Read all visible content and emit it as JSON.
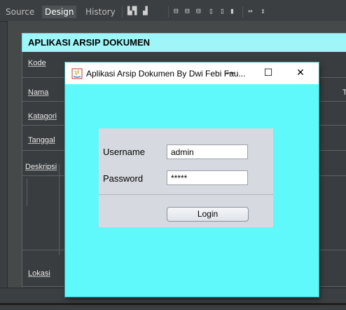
{
  "ide": {
    "tabs": [
      {
        "label": "Source"
      },
      {
        "label": "Design"
      },
      {
        "label": "History"
      }
    ]
  },
  "form": {
    "header_title": "APLIKASI ARSIP DOKUMEN",
    "labels": {
      "kode": "Kode",
      "nama": "Nama",
      "katagori": "Katagori",
      "tanggal": "Tanggal",
      "deskripsi": "Deskripsi",
      "lokasi": "Lokasi"
    },
    "right_edge_char": "T"
  },
  "dialog": {
    "title": "Aplikasi Arsip Dokumen By Dwi Febi Fau...",
    "minimize": "—",
    "maximize": "☐",
    "close": "✕",
    "username_label": "Username",
    "username_value": "admin",
    "password_label": "Password",
    "password_value": "*****",
    "login_label": "Login"
  },
  "colors": {
    "dialog_bg": "#5ff9fc",
    "header_bg": "#9ff5f8",
    "panel_bg": "#d6d9df"
  }
}
